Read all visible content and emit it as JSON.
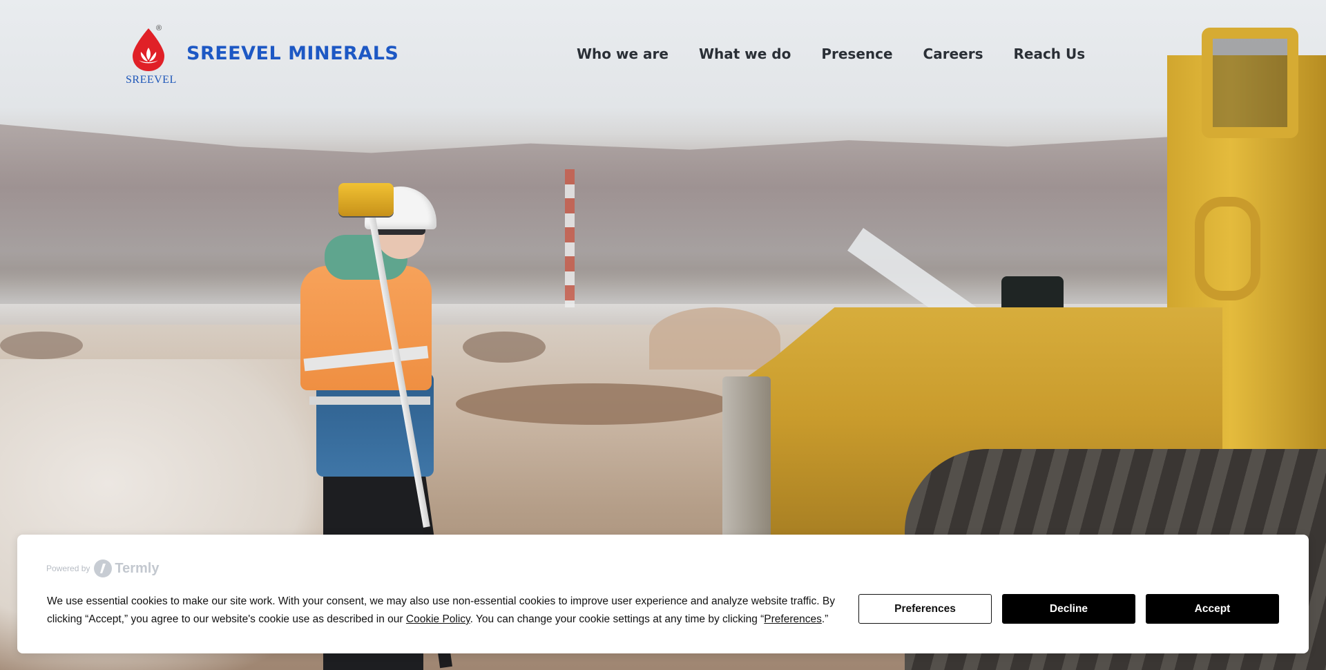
{
  "header": {
    "logo_sub": "SREEVEL",
    "logo_registered": "®",
    "brand_name": "SREEVEL MINERALS",
    "nav": [
      "Who we are",
      "What we do",
      "Presence",
      "Careers",
      "Reach Us"
    ]
  },
  "hero": {
    "image_alt": "surveyor-with-gps-near-yellow-loader"
  },
  "cookie_banner": {
    "powered_by": "Powered by",
    "provider": "Termly",
    "text_before_link": "We use essential cookies to make our site work. With your consent, we may also use non-essential cookies to improve user experience and analyze website traffic. By clicking “Accept,” you agree to our website's cookie use as described in our ",
    "cookie_policy_link": "Cookie Policy",
    "text_middle": ". You can change your cookie settings at any time by clicking “",
    "preferences_link": "Preferences",
    "text_end": ".”",
    "buttons": {
      "preferences": "Preferences",
      "decline": "Decline",
      "accept": "Accept"
    }
  },
  "colors": {
    "brand_blue": "#1d58c4",
    "logo_red": "#e02027",
    "nav_text": "#2a2f36",
    "button_black": "#000000"
  },
  "icons": {
    "logo": "lotus-drop-icon",
    "termly": "termly-logo-icon"
  }
}
